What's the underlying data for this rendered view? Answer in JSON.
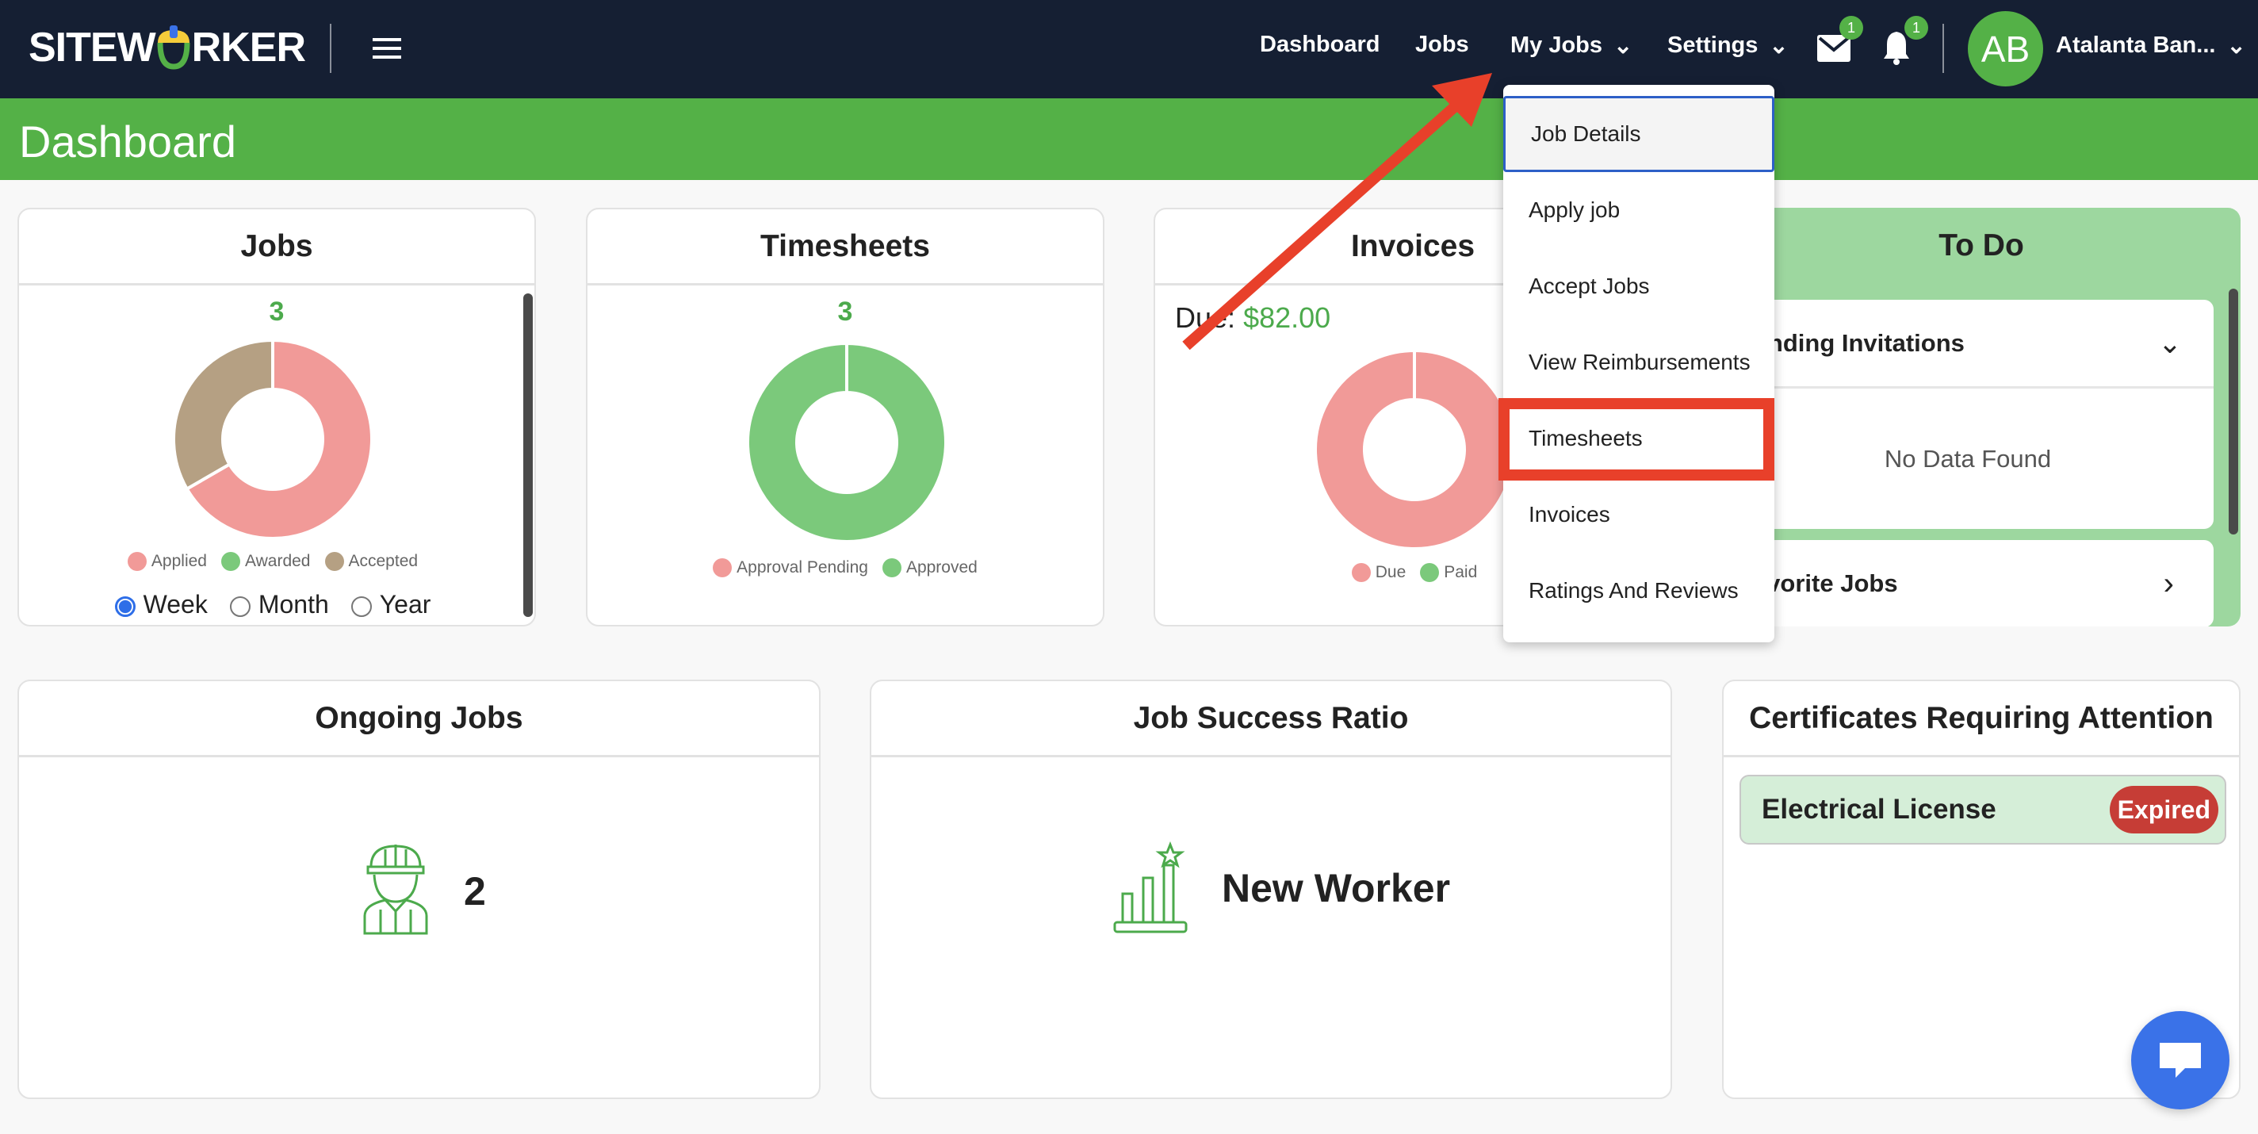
{
  "navbar": {
    "logo": "SITEWORKER",
    "logo_left": "SITEW",
    "logo_right": "RKER",
    "links": [
      "Dashboard",
      "Jobs",
      "My Jobs",
      "Settings"
    ],
    "mail_badge": "1",
    "bell_badge": "1",
    "avatar_initials": "AB",
    "user_name": "Atalanta Ban..."
  },
  "page_title": "Dashboard",
  "colors": {
    "navbar": "#151f33",
    "brand_green": "#54b147",
    "applied": "#f19a98",
    "awarded": "#7bc97b",
    "accepted": "#b5a083",
    "todo_bg": "#9dd79f",
    "expired": "#c63d36",
    "chat": "#3a72e8",
    "highlight": "#e8402a"
  },
  "jobs": {
    "title": "Jobs",
    "count": "3",
    "legend": [
      "Applied",
      "Awarded",
      "Accepted"
    ],
    "radios": [
      "Week",
      "Month",
      "Year"
    ],
    "selected": "Week"
  },
  "timesheets": {
    "title": "Timesheets",
    "count": "3",
    "legend": [
      "Approval Pending",
      "Approved"
    ]
  },
  "invoices": {
    "title": "Invoices",
    "due_label": "Due:",
    "due_amount": "$82.00",
    "legend": [
      "Due",
      "Paid"
    ]
  },
  "todo": {
    "title": "To Do",
    "pending": "Pending Invitations",
    "empty": "No Data Found",
    "favorites": "Favorite Jobs"
  },
  "dropdown": {
    "items": [
      "Job Details",
      "Apply job",
      "Accept Jobs",
      "View Reimbursements",
      "Timesheets",
      "Invoices",
      "Ratings And Reviews"
    ],
    "hovered": "Job Details",
    "highlighted": "Timesheets"
  },
  "ongoing": {
    "title": "Ongoing Jobs",
    "value": "2"
  },
  "success": {
    "title": "Job Success Ratio",
    "value": "New Worker"
  },
  "certs": {
    "title": "Certificates Requiring Attention",
    "items": [
      {
        "name": "Electrical License",
        "status": "Expired"
      }
    ]
  },
  "chart_data": [
    {
      "type": "pie",
      "donut": true,
      "title": "Jobs",
      "categories": [
        "Applied",
        "Awarded",
        "Accepted"
      ],
      "values": [
        2,
        0,
        1
      ],
      "colors": [
        "#f19a98",
        "#7bc97b",
        "#b5a083"
      ]
    },
    {
      "type": "pie",
      "donut": true,
      "title": "Timesheets",
      "categories": [
        "Approval Pending",
        "Approved"
      ],
      "values": [
        0,
        3
      ],
      "colors": [
        "#f19a98",
        "#7bc97b"
      ]
    },
    {
      "type": "pie",
      "donut": true,
      "title": "Invoices",
      "categories": [
        "Due",
        "Paid"
      ],
      "values": [
        82,
        0
      ],
      "colors": [
        "#f19a98",
        "#7bc97b"
      ]
    }
  ]
}
